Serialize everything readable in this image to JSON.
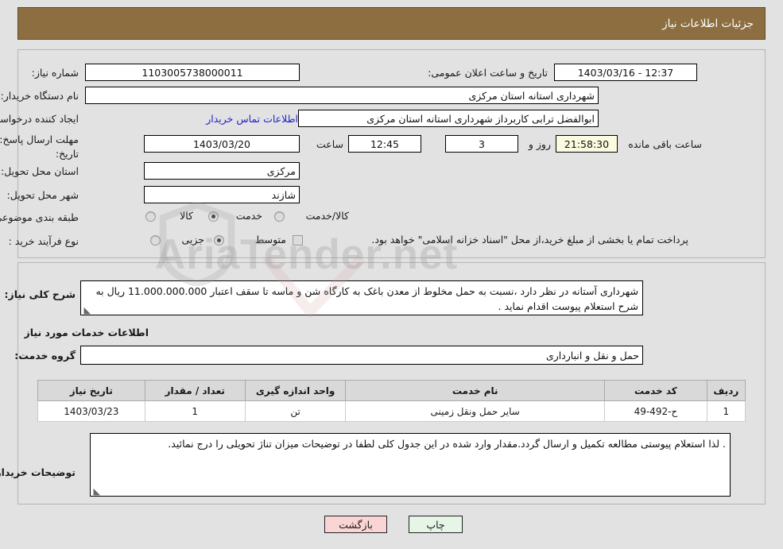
{
  "header": {
    "title": "جزئیات اطلاعات نیاز",
    "bg_color": "#8d6e41"
  },
  "top_form": {
    "need_number_label": "شماره نیاز:",
    "need_number_value": "1103005738000011",
    "announce_datetime_label": "تاریخ و ساعت اعلان عمومی:",
    "announce_datetime_value": "1403/03/16 - 12:37",
    "buyer_org_label": "نام دستگاه خریدار:",
    "buyer_org_value": "شهرداری استانه استان مرکزی",
    "requester_label": "ایجاد کننده درخواست:",
    "requester_value": "ابوالفضل ترابی  کاربرداز  شهرداری استانه استان مرکزی",
    "contact_link": "اطلاعات تماس خریدار",
    "deadline_label_line1": "مهلت ارسال پاسخ: تا",
    "deadline_label_line2": "تاریخ:",
    "deadline_date": "1403/03/20",
    "time_label": "ساعت",
    "deadline_time": "12:45",
    "days_value": "3",
    "days_label": "روز و",
    "remaining_time": "21:58:30",
    "remaining_label": "ساعت باقی مانده",
    "province_label": "استان محل تحویل:",
    "province_value": "مرکزی",
    "city_label": "شهر محل تحویل:",
    "city_value": "شازند",
    "category_label": "طبقه بندی موضوعی:",
    "category_options": [
      "کالا",
      "خدمت",
      "کالا/خدمت"
    ],
    "purchase_type_label": "نوع فرآیند خرید :",
    "purchase_type_options": [
      "جزیی",
      "متوسط"
    ],
    "treasury_note": "پرداخت تمام یا بخشی از مبلغ خرید،از محل \"اسناد خزانه اسلامی\" خواهد بود."
  },
  "bottom_form": {
    "summary_label": "شرح کلی نیاز:",
    "summary_value": "شهرداری آستانه در نظر دارد ،نسبت به حمل مخلوط از معدن باغک به کارگاه شن و ماسه تا سقف اعتبار 11.000.000.000 ریال به شرح استعلام پیوست اقدام نماید .",
    "services_section_title": "اطلاعات خدمات مورد نیاز",
    "service_group_label": "گروه خدمت:",
    "service_group_value": "حمل و نقل و انبارداری",
    "table": {
      "headers": [
        "ردیف",
        "کد خدمت",
        "نام خدمت",
        "واحد اندازه گیری",
        "تعداد / مقدار",
        "تاریخ نیاز"
      ],
      "rows": [
        {
          "row": "1",
          "code": "ح-492-49",
          "name": "سایر حمل ونقل زمینی",
          "unit": "تن",
          "qty": "1",
          "date": "1403/03/23"
        }
      ]
    },
    "buyer_notes_label": "توضیحات خریدار:",
    "buyer_notes_value": ". لذا استعلام پیوستی مطالعه تکمیل  و ارسال گردد.مقدار وارد شده در این جدول کلی لطفا در توضیحات میزان تناژ تحویلی را درج نمائید."
  },
  "footer": {
    "print_label": "چاپ",
    "back_label": "بازگشت"
  },
  "watermark": {
    "text": "AriaTender.net"
  }
}
